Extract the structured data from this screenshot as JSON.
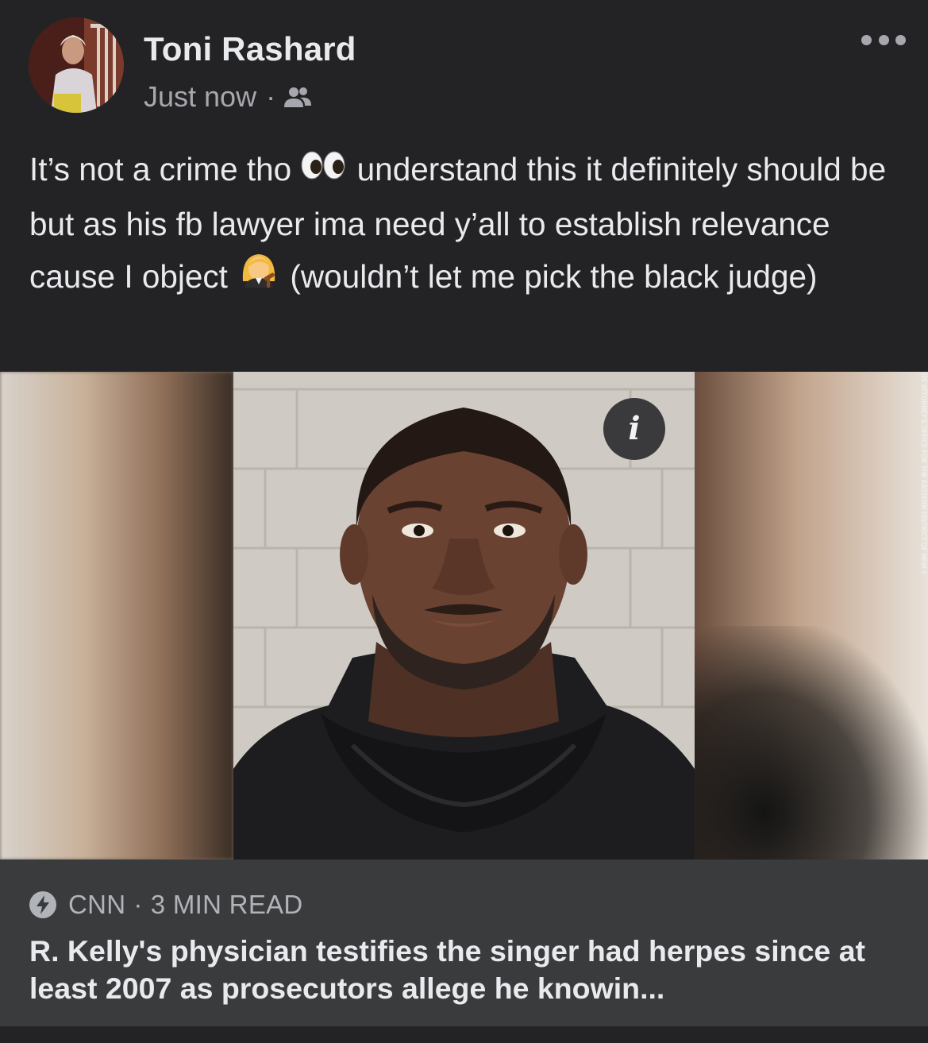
{
  "post": {
    "author": "Toni Rashard",
    "timestamp": "Just now",
    "separator": "·",
    "audience_icon": "friends-icon",
    "more_icon": "more-options-icon",
    "text_before_eyes": "It’s not a crime tho ",
    "eyes_emoji_name": "eyes-emoji",
    "text_after_eyes": " understand this it definitely should be but as his fb lawyer ima need y’all to establish relevance cause I object ",
    "judge_emoji_name": "woman-judge-emoji",
    "text_after_judge": " (wouldn’t let me pick the black judge)"
  },
  "link_preview": {
    "info_icon_label": "i",
    "photo_credit": "US ATTORNEY'S OFFICE FOR THE EASTERN DISTRICT OF NEW Y",
    "source_icon": "lightning-bolt-icon",
    "source": "CNN",
    "separator": "·",
    "read_time": "3 MIN READ",
    "headline": "R. Kelly's physician testifies the singer had herpes since at least 2007 as prosecutors allege he knowin..."
  },
  "colors": {
    "background": "#232325",
    "card": "#3a3b3d",
    "primary_text": "#e9eaee",
    "secondary_text": "#a6a8ad"
  }
}
